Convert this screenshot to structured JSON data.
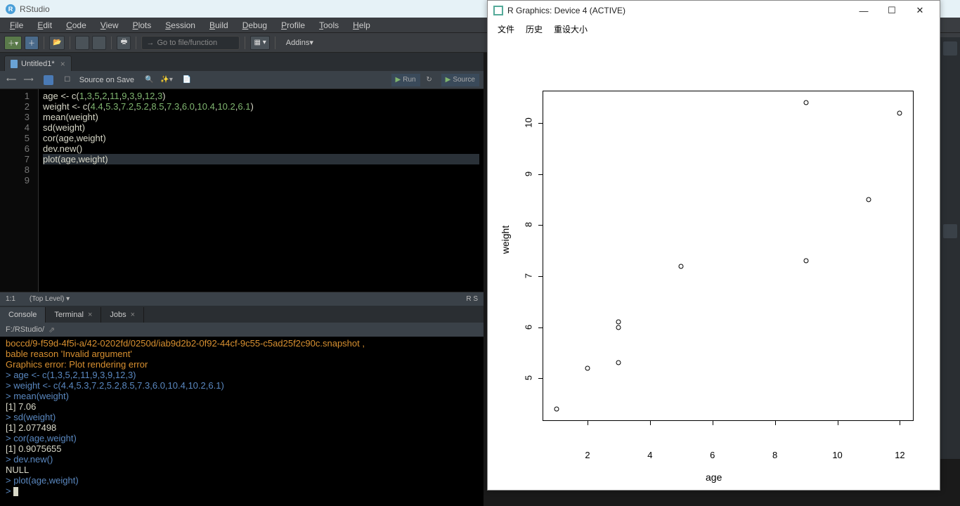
{
  "app_title": "RStudio",
  "menubar": [
    "File",
    "Edit",
    "Code",
    "View",
    "Plots",
    "Session",
    "Build",
    "Debug",
    "Profile",
    "Tools",
    "Help"
  ],
  "toolbar": {
    "goto_placeholder": "Go to file/function",
    "addins_label": "Addins"
  },
  "editor": {
    "tab_name": "Untitled1*",
    "source_on_save": "Source on Save",
    "run_label": "Run",
    "source_label": "Source",
    "line_numbers": [
      "1",
      "2",
      "3",
      "4",
      "5",
      "6",
      "7",
      "8",
      "9"
    ],
    "code_lines": [
      {
        "raw": "age <- c(1,3,5,2,11,9,3,9,12,3)",
        "hl": false
      },
      {
        "raw": "weight <- c(4.4,5.3,7.2,5.2,8.5,7.3,6.0,10.4,10.2,6.1)",
        "hl": false
      },
      {
        "raw": "mean(weight)",
        "hl": false
      },
      {
        "raw": "sd(weight)",
        "hl": false
      },
      {
        "raw": "cor(age,weight)",
        "hl": false
      },
      {
        "raw": "dev.new()",
        "hl": false
      },
      {
        "raw": "plot(age,weight)",
        "hl": true
      },
      {
        "raw": "",
        "hl": false
      },
      {
        "raw": "",
        "hl": false
      }
    ],
    "status_pos": "1:1",
    "status_scope": "(Top Level)",
    "status_lang": "R S"
  },
  "console": {
    "tabs": [
      "Console",
      "Terminal",
      "Jobs"
    ],
    "path": "F:/RStudio/",
    "lines": [
      {
        "cls": "warn",
        "text": "boccd/9-f59d-4f5i-a/42-0202fd/0250d/iab9d2b2-0f92-44cf-9c55-c5ad25f2c90c.snapshot ,"
      },
      {
        "cls": "warn",
        "text": "bable reason 'Invalid argument'"
      },
      {
        "cls": "warn",
        "text": "Graphics error: Plot rendering error"
      },
      {
        "cls": "cmd",
        "text": "> age <- c(1,3,5,2,11,9,3,9,12,3)"
      },
      {
        "cls": "cmd",
        "text": "> weight <- c(4.4,5.3,7.2,5.2,8.5,7.3,6.0,10.4,10.2,6.1)"
      },
      {
        "cls": "cmd",
        "text": "> mean(weight)"
      },
      {
        "cls": "",
        "text": "[1] 7.06"
      },
      {
        "cls": "cmd",
        "text": "> sd(weight)"
      },
      {
        "cls": "",
        "text": "[1] 2.077498"
      },
      {
        "cls": "cmd",
        "text": "> cor(age,weight)"
      },
      {
        "cls": "",
        "text": "[1] 0.9075655"
      },
      {
        "cls": "cmd",
        "text": "> dev.new()"
      },
      {
        "cls": "",
        "text": "NULL"
      },
      {
        "cls": "cmd",
        "text": "> plot(age,weight)"
      },
      {
        "cls": "cmd",
        "text": "> "
      }
    ]
  },
  "gfx": {
    "title": "R Graphics: Device 4 (ACTIVE)",
    "menu": [
      "文件",
      "历史",
      "重设大小"
    ]
  },
  "chart_data": {
    "type": "scatter",
    "xlabel": "age",
    "ylabel": "weight",
    "x": [
      1,
      3,
      5,
      2,
      11,
      9,
      3,
      9,
      12,
      3
    ],
    "y": [
      4.4,
      5.3,
      7.2,
      5.2,
      8.5,
      7.3,
      6.0,
      10.4,
      10.2,
      6.1
    ],
    "x_ticks": [
      2,
      4,
      6,
      8,
      10,
      12
    ],
    "y_ticks": [
      5,
      6,
      7,
      8,
      9,
      10
    ],
    "xlim": [
      1,
      12
    ],
    "ylim": [
      4.4,
      10.4
    ]
  }
}
